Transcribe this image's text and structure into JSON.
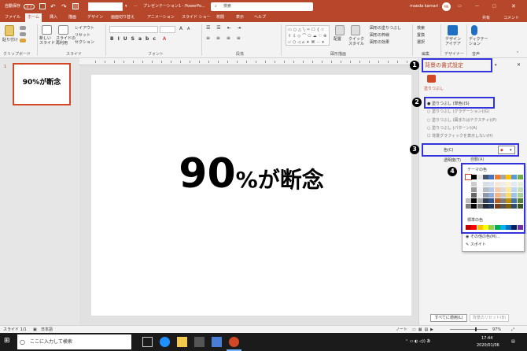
{
  "titlebar": {
    "autosave": "自動保存",
    "autosave_state": "オフ",
    "doc_title": "プレゼンテーション1 - PowerPo...",
    "search_placeholder": "検索",
    "user": "maeda kamari",
    "user_initials": "MK"
  },
  "ribbon_tabs": [
    "ファイル",
    "ホーム",
    "挿入",
    "描画",
    "デザイン",
    "画面切り替え",
    "アニメーション",
    "スライド ショー",
    "校閲",
    "表示",
    "ヘルプ"
  ],
  "share": {
    "share_label": "共有",
    "comment_label": "コメント"
  },
  "ribbon": {
    "paste": "貼り付け",
    "new_slide": "新しい\nスライド",
    "reuse_slide": "スライドの\n再利用",
    "layout": "レイアウト",
    "reset": "リセット",
    "section": "セクション",
    "picture": "図形",
    "arrange": "配置",
    "quick_style": "クイック\nスタイル",
    "fill": "図形の塗りつぶし",
    "outline": "図形の枠線",
    "effect": "図形の効果",
    "find": "検索",
    "replace": "置換",
    "select": "選択",
    "design_ideas": "デザイン\nアイデア",
    "dictate": "ディクテー\nション",
    "groups": {
      "clipboard": "クリップボード",
      "slides": "スライド",
      "font": "フォント",
      "paragraph": "段落",
      "drawing": "図形描画",
      "editing": "編集",
      "designer": "デザイナー",
      "voice": "音声"
    }
  },
  "thumbnail": {
    "number": "1",
    "text": "90%が断念"
  },
  "slide": {
    "big": "90",
    "rest": "%が断念"
  },
  "format_pane": {
    "title": "背景の書式設定",
    "section": "塗りつぶし",
    "options": [
      "塗りつぶし (単色)(S)",
      "塗りつぶし (グラデーション)(G)",
      "塗りつぶし (図またはテクスチャ)(P)",
      "塗りつぶし (パターン)(A)",
      "背景グラフィックを表示しない(H)"
    ],
    "color_label": "色(C)",
    "transparency_label": "透明度(T)",
    "auto": "自動(A)",
    "theme_colors": "テーマの色",
    "standard_colors": "標準の色",
    "more_colors": "その他の色(M)...",
    "eyedropper": "スポイト",
    "apply_all": "すべてに適用(L)",
    "reset_bg": "背景のリセット(B)"
  },
  "badges": [
    "1",
    "2",
    "3",
    "4"
  ],
  "status": {
    "slide": "スライド 1/1",
    "lang": "日本語",
    "notes": "ノート",
    "zoom": "97%"
  },
  "taskbar": {
    "search": "ここに入力して検索",
    "time": "17:44",
    "date": "2020/01/06"
  },
  "colors": {
    "accent": "#b7472a",
    "highlight": "#3333dd",
    "theme_row": [
      "#ffffff",
      "#000000",
      "#e7e6e6",
      "#44546a",
      "#4472c4",
      "#ed7d31",
      "#a5a5a5",
      "#ffc000",
      "#5b9bd5",
      "#70ad47"
    ],
    "standard_row": [
      "#c00000",
      "#ff0000",
      "#ffc000",
      "#ffff00",
      "#92d050",
      "#00b050",
      "#00b0f0",
      "#0070c0",
      "#002060",
      "#7030a0"
    ]
  }
}
